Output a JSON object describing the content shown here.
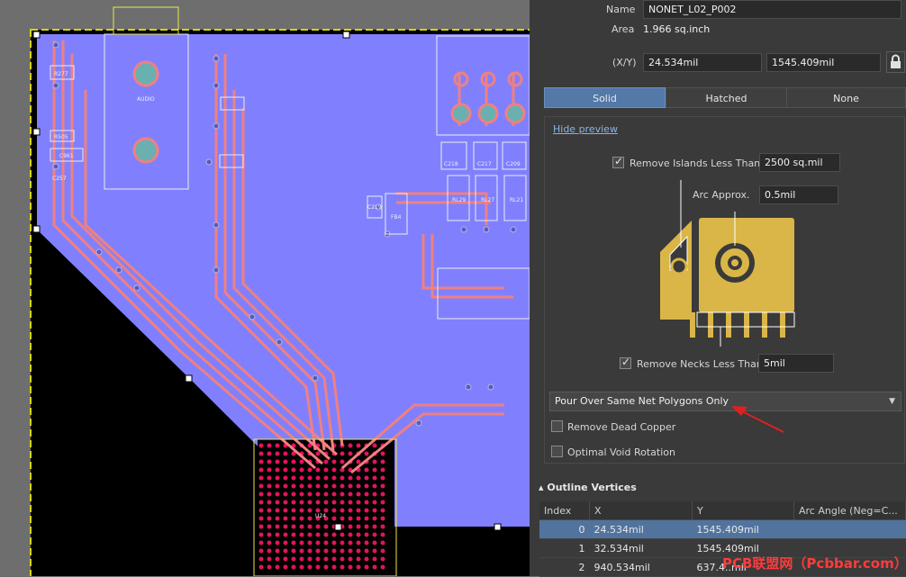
{
  "properties": {
    "name_label": "Name",
    "name_value": "NONET_L02_P002",
    "area_label": "Area",
    "area_value": "1.966 sq.inch",
    "xy_label": "(X/Y)",
    "x_value": "24.534mil",
    "y_value": "1545.409mil"
  },
  "fill_modes": {
    "solid": "Solid",
    "hatched": "Hatched",
    "none": "None",
    "active": "solid"
  },
  "options": {
    "hide_preview": "Hide preview",
    "remove_islands_label": "Remove Islands Less Than",
    "remove_islands_value": "2500 sq.mil",
    "remove_islands_checked": true,
    "arc_approx_label": "Arc Approx.",
    "arc_approx_value": "0.5mil",
    "remove_necks_label": "Remove Necks Less Than",
    "remove_necks_value": "5mil",
    "remove_necks_checked": true,
    "pour_over": "Pour Over Same Net Polygons Only",
    "remove_dead_copper": "Remove Dead Copper",
    "remove_dead_copper_checked": false,
    "optimal_void_rotation": "Optimal Void Rotation",
    "optimal_void_rotation_checked": false
  },
  "outline": {
    "title": "Outline Vertices",
    "columns": [
      "Index",
      "X",
      "Y",
      "Arc Angle (Neg=C..."
    ],
    "rows": [
      {
        "index": "0",
        "x": "24.534mil",
        "y": "1545.409mil",
        "arc": ""
      },
      {
        "index": "1",
        "x": "32.534mil",
        "y": "1545.409mil",
        "arc": ""
      },
      {
        "index": "2",
        "x": "940.534mil",
        "y": "637.4..mil",
        "arc": ""
      }
    ]
  },
  "pcb_labels": [
    "AUDIO",
    "R277",
    "R505",
    "C961",
    "C257",
    "C218",
    "C217",
    "C209",
    "RL29",
    "RL27",
    "RL21",
    "C219",
    "FB4",
    "U24"
  ],
  "watermark": "PCB联盟网（Pcbbar.com）",
  "colors": {
    "polygon": "#8080ff",
    "trace": "#f08080",
    "board_edge": "#d6d600",
    "accent": "#5379a8",
    "preview_copper": "#dab648"
  }
}
